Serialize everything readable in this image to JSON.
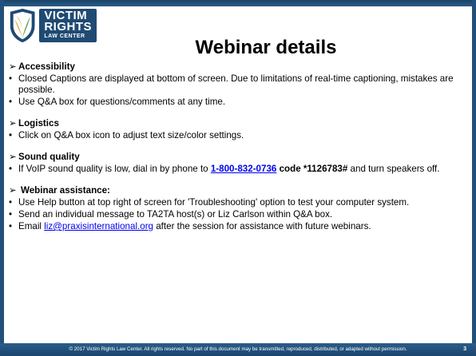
{
  "logo": {
    "line1": "VICTIM",
    "line2": "RIGHTS",
    "line3": "LAW CENTER",
    "colors": {
      "shield_gold": "#d8a42b",
      "shield_blue": "#1f4a73",
      "shield_green": "#6aa84f"
    }
  },
  "title": "Webinar details",
  "sections": [
    {
      "heading": "Accessibility",
      "bullets": [
        "Closed Captions are displayed at bottom of screen. Due to limitations of real-time captioning, mistakes are possible.",
        "Use Q&A box for questions/comments at any time."
      ]
    },
    {
      "heading": "Logistics",
      "bullets": [
        "Click on Q&A box icon to adjust text size/color settings."
      ]
    },
    {
      "heading": "Sound quality",
      "bullet_pre": "If VoIP sound quality is low, dial in by phone to ",
      "phone": "1-800-832-0736",
      "code_text": " code *1126783#",
      "bullet_post": " and turn speakers off."
    },
    {
      "heading": "Webinar assistance:",
      "bullets": [
        "Use Help button at top right of screen for 'Troubleshooting' option to test your computer system.",
        "Send an individual message to TA2TA host(s) or Liz Carlson within Q&A box."
      ],
      "email_pre": "Email ",
      "email": "liz@praxisinternational.org",
      "email_post": " after the session for assistance with future webinars."
    }
  ],
  "footer": {
    "text": "© 2017 Victim Rights Law Center. All rights reserved. No part of this document may be transmitted, reproduced, distributed, or adapted without permission.",
    "page": "3"
  },
  "colors": {
    "frame": "#23507a",
    "link": "#0000ee"
  }
}
